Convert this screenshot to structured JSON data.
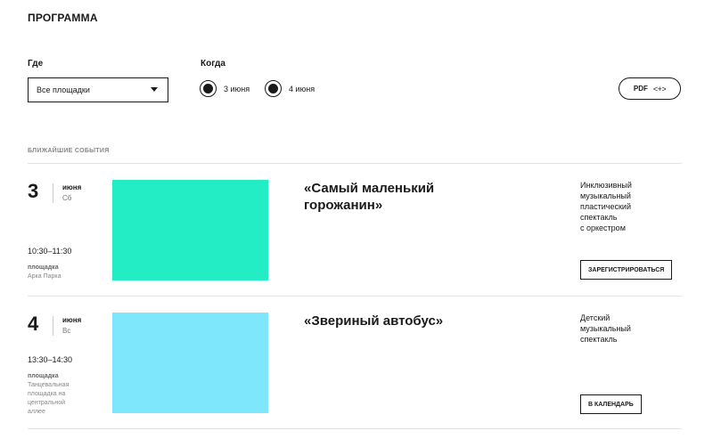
{
  "header": {
    "title": "ПРОГРАММА"
  },
  "filters": {
    "where_label": "Где",
    "venue_select": {
      "value": "Все площадки"
    },
    "when_label": "Когда",
    "dates": [
      {
        "label": "3 июня",
        "selected": true
      },
      {
        "label": "4 июня",
        "selected": true
      }
    ],
    "pdf_button": {
      "label": "PDF",
      "icon": "<+>"
    }
  },
  "events_section": {
    "heading": "БЛИЖАЙШИЕ СОБЫТИЯ",
    "events": [
      {
        "day": "3",
        "month": "июня",
        "weekday": "Сб",
        "time": "10:30–11:30",
        "venue_label": "площадка",
        "venue": "Арка Парка",
        "image_color": "#22EDC4",
        "title": "«Самый маленький горожанин»",
        "description": [
          "Инклюзивный",
          "музыкальный",
          "пластический",
          "спектакль",
          "с оркестром"
        ],
        "action_label": "ЗАРЕГИСТРИРОВАТЬСЯ"
      },
      {
        "day": "4",
        "month": "июня",
        "weekday": "Вс",
        "time": "13:30–14:30",
        "venue_label": "площадка",
        "venue": "Танцевальная площадка на центральной аллее",
        "image_color": "#7EE7FC",
        "title": "«Звериный автобус»",
        "description": [
          "Детский",
          "музыкальный",
          "спектакль"
        ],
        "action_label": "В КАЛЕНДАРЬ"
      }
    ]
  }
}
